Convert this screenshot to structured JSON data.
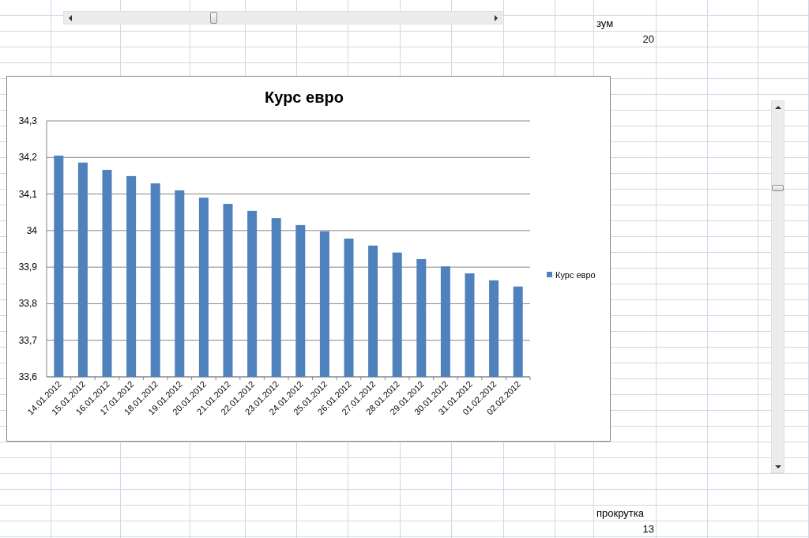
{
  "sheet": {
    "cells": [
      {
        "label": "зум",
        "value": "20"
      },
      {
        "label": "прокрутка",
        "value": "13"
      }
    ]
  },
  "horizontal_scrollbar": {
    "level": 0.33
  },
  "vertical_scrollbar": {
    "level": 0.79
  },
  "chart": {
    "chart_data": {
      "type": "bar",
      "title": "Курс евро",
      "grid": true,
      "categories": [
        "14.01.2012",
        "15.01.2012",
        "16.01.2012",
        "17.01.2012",
        "18.01.2012",
        "19.01.2012",
        "20.01.2012",
        "21.01.2012",
        "22.01.2012",
        "23.01.2012",
        "24.01.2012",
        "25.01.2012",
        "26.01.2012",
        "27.01.2012",
        "28.01.2012",
        "29.01.2012",
        "30.01.2012",
        "31.01.2012",
        "01.02.2012",
        "02.02.2012"
      ],
      "series": [
        {
          "name": "Курс евро",
          "color": "#4f81bd",
          "values": [
            34.205,
            34.186,
            34.166,
            34.149,
            34.129,
            34.11,
            34.09,
            34.073,
            34.054,
            34.034,
            34.015,
            33.998,
            33.978,
            33.959,
            33.94,
            33.922,
            33.902,
            33.883,
            33.864,
            33.847
          ]
        }
      ],
      "ylim": [
        33.6,
        34.3
      ],
      "yticks": [
        {
          "value": 33.6,
          "label": "33,6"
        },
        {
          "value": 33.7,
          "label": "33,7"
        },
        {
          "value": 33.8,
          "label": "33,8"
        },
        {
          "value": 33.9,
          "label": "33,9"
        },
        {
          "value": 34,
          "label": "34"
        },
        {
          "value": 34.1,
          "label": "34,1"
        },
        {
          "value": 34.2,
          "label": "34,2"
        },
        {
          "value": 34.3,
          "label": "34,3"
        }
      ]
    }
  }
}
